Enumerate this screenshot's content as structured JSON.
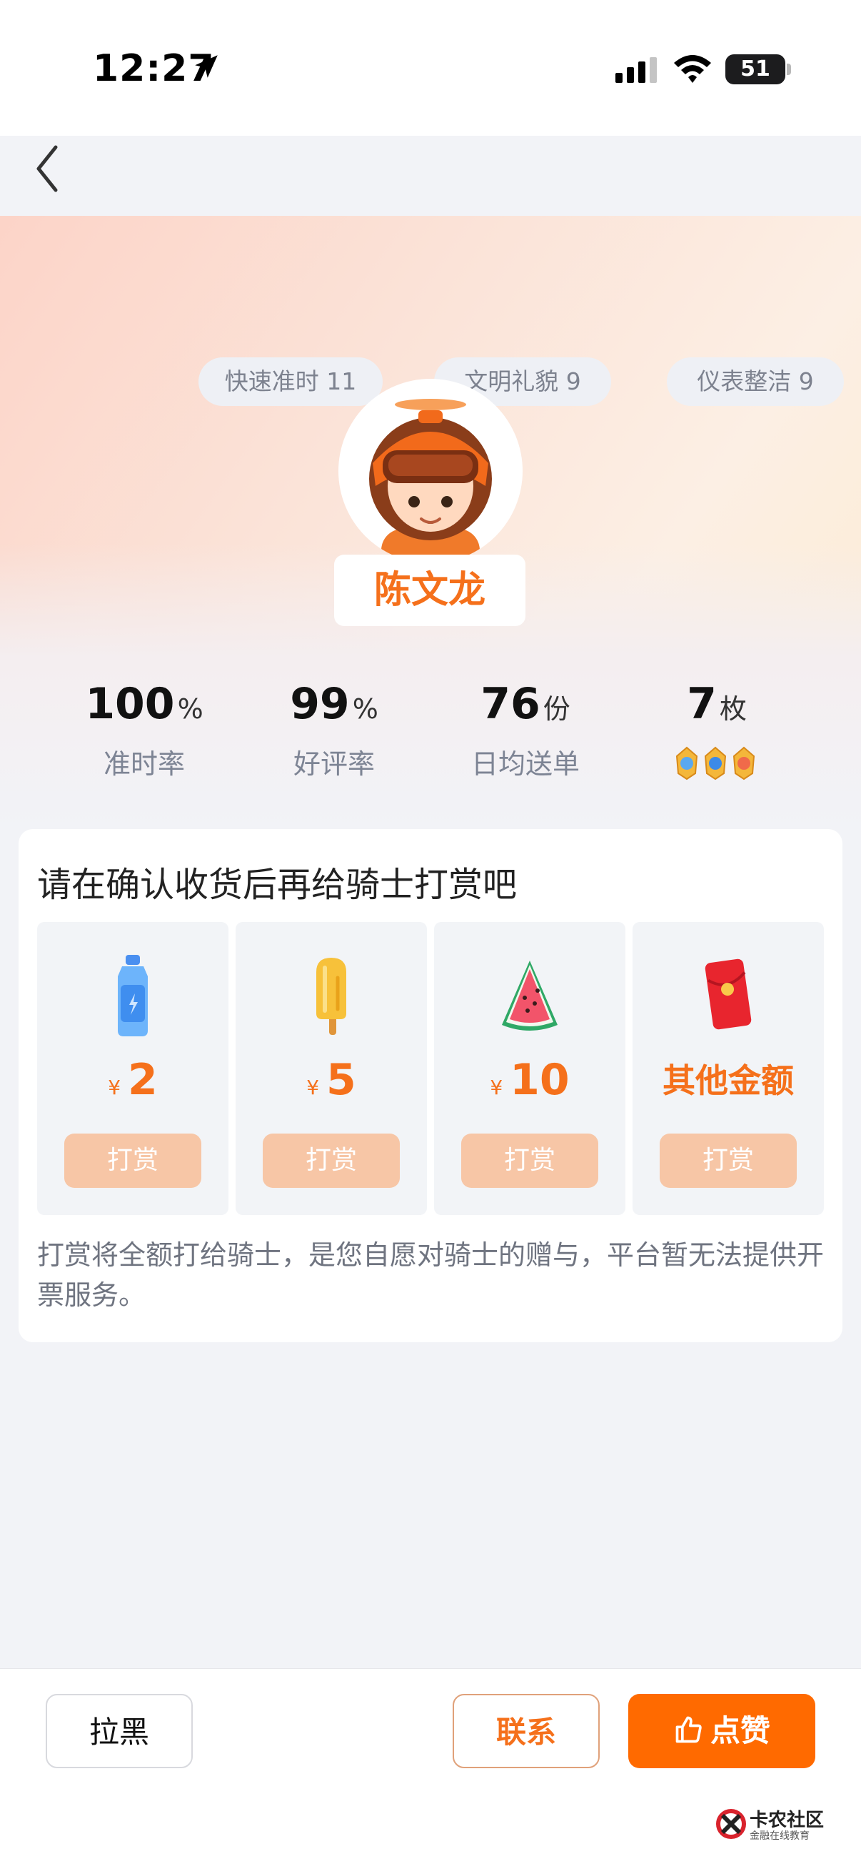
{
  "status_bar": {
    "time": "12:27",
    "battery": "51"
  },
  "rider": {
    "tags": [
      "快速准时 11",
      "文明礼貌 9",
      "仪表整洁 9"
    ],
    "name": "陈文龙"
  },
  "stats": [
    {
      "value": "100",
      "unit": "%",
      "label": "准时率"
    },
    {
      "value": "99",
      "unit": "%",
      "label": "好评率"
    },
    {
      "value": "76",
      "unit": "份",
      "label": "日均送单"
    },
    {
      "value": "7",
      "unit": "枚",
      "label": ""
    }
  ],
  "tip_card": {
    "title": "请在确认收货后再给骑士打赏吧",
    "options": [
      {
        "icon": "water-bottle-icon",
        "currency": "¥",
        "amount": "2",
        "button": "打赏"
      },
      {
        "icon": "popsicle-icon",
        "currency": "¥",
        "amount": "5",
        "button": "打赏"
      },
      {
        "icon": "watermelon-icon",
        "currency": "¥",
        "amount": "10",
        "button": "打赏"
      },
      {
        "icon": "red-envelope-icon",
        "other_label": "其他金额",
        "button": "打赏"
      }
    ],
    "notice": "打赏将全额打给骑士，是您自愿对骑士的赠与，平台暂无法提供开票服务。"
  },
  "bottom_bar": {
    "block_label": "拉黑",
    "contact_label": "联系",
    "like_label": "点赞"
  },
  "watermark": {
    "name": "卡农社区",
    "sub": "金融在线教育"
  },
  "colors": {
    "accent": "#ff6a00",
    "accent_text": "#f5701b",
    "tip_button": "#f7c6a6"
  }
}
